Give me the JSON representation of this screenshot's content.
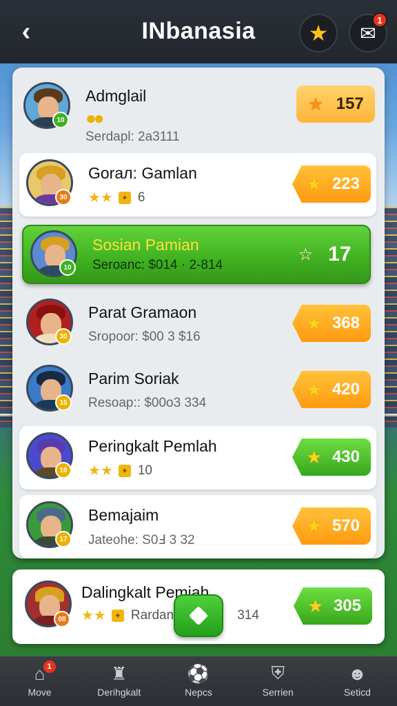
{
  "header": {
    "title": "INbanasia",
    "back_icon": "chevron-left-icon",
    "star_icon": "star-icon",
    "mail_icon": "mail-icon",
    "mail_badge": "1"
  },
  "leaderboard": [
    {
      "name": "Admglail",
      "sub": "Serdapl: 2a3111",
      "score": "157",
      "style": "top",
      "stars": "",
      "count": ""
    },
    {
      "name": "Gorал: Gamlan",
      "sub": "",
      "score": "223",
      "style": "orange",
      "stars": "★★",
      "count": "6"
    },
    {
      "name": "Sosian Pamian",
      "sub": "Seroanc: $014 · 2-814",
      "score": "17",
      "style": "selected",
      "stars": "",
      "count": ""
    },
    {
      "name": "Parat Gramaon",
      "sub": "Sropoor: $00 3 $16",
      "score": "368",
      "style": "orange",
      "stars": "",
      "count": ""
    },
    {
      "name": "Parim Soriak",
      "sub": "Resoap:: $00o3 334",
      "score": "420",
      "style": "orange",
      "stars": "",
      "count": ""
    },
    {
      "name": "Peringkalt Pemlah",
      "sub": "",
      "score": "430",
      "style": "green",
      "stars": "★★",
      "count": "10"
    },
    {
      "name": "Bemajaim",
      "sub": "Jateohe: S0Ⅎ 3 32",
      "score": "570",
      "style": "orange",
      "stars": "",
      "count": ""
    }
  ],
  "featured": {
    "name": "Dalingkalt Pemiah",
    "stars": "★★",
    "sub": "Rardan",
    "sub_tail": "314",
    "score": "305"
  },
  "nav": [
    {
      "label": "Move",
      "icon": "home-icon",
      "badge": "1"
    },
    {
      "label": "Derihgkalt",
      "icon": "trophy-icon",
      "badge": ""
    },
    {
      "label": "Nepcs",
      "icon": "sports-icon",
      "badge": ""
    },
    {
      "label": "Serrien",
      "icon": "shield-icon",
      "badge": ""
    },
    {
      "label": "Seticd",
      "icon": "profile-icon",
      "badge": ""
    }
  ],
  "colors": {
    "header_bg": "#22262d",
    "selected_row": "#3fb020",
    "score_orange": "#ff9a10",
    "score_green": "#37a81c",
    "star_gold": "#f2b411"
  }
}
